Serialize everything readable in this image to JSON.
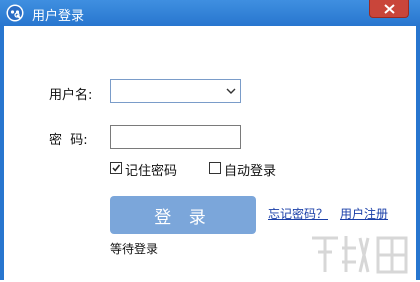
{
  "window": {
    "title": "用户登录",
    "close_symbol": "✕"
  },
  "form": {
    "username_label": "用户名:",
    "username_value": "",
    "password_label": "密  码:",
    "password_value": "",
    "remember_password": {
      "label": "记住密码",
      "checked": true
    },
    "auto_login": {
      "label": "自动登录",
      "checked": false
    },
    "login_button": "登 录",
    "forgot_password_link": "忘记密码？",
    "register_link": "用户注册",
    "status_text": "等待登录"
  },
  "colors": {
    "title_bar": "#2876cf",
    "login_button": "#7ba6da",
    "close_button": "#c9453a",
    "link": "#1a3fa8"
  }
}
